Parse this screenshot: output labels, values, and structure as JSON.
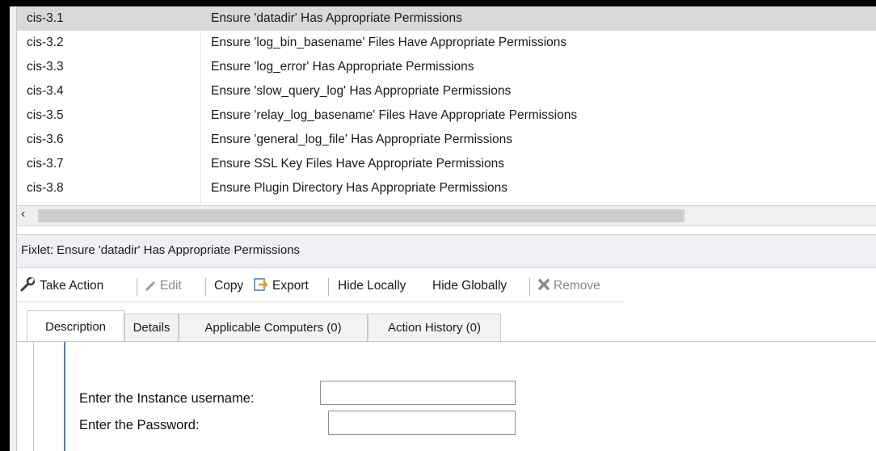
{
  "list": {
    "rows": [
      {
        "id": "cis-3.1",
        "name": "Ensure 'datadir' Has Appropriate Permissions",
        "selected": true
      },
      {
        "id": "cis-3.2",
        "name": "Ensure 'log_bin_basename' Files Have Appropriate Permissions"
      },
      {
        "id": "cis-3.3",
        "name": "Ensure 'log_error' Has Appropriate Permissions"
      },
      {
        "id": "cis-3.4",
        "name": "Ensure 'slow_query_log' Has Appropriate Permissions"
      },
      {
        "id": "cis-3.5",
        "name": "Ensure 'relay_log_basename' Files Have Appropriate Permissions"
      },
      {
        "id": "cis-3.6",
        "name": "Ensure 'general_log_file' Has Appropriate Permissions"
      },
      {
        "id": "cis-3.7",
        "name": "Ensure SSL Key Files Have Appropriate Permissions"
      },
      {
        "id": "cis-3.8",
        "name": "Ensure Plugin Directory Has Appropriate Permissions"
      }
    ]
  },
  "fixlet": {
    "header": "Fixlet: Ensure 'datadir' Has Appropriate Permissions"
  },
  "toolbar": {
    "take_action": "Take Action",
    "edit": "Edit",
    "copy": "Copy",
    "export": "Export",
    "hide_locally": "Hide Locally",
    "hide_globally": "Hide Globally",
    "remove": "Remove"
  },
  "tabs": {
    "description": "Description",
    "details": "Details",
    "applicable": "Applicable Computers (0)",
    "history": "Action History (0)"
  },
  "form": {
    "username_label": "Enter the Instance username:",
    "username_value": "",
    "password_label": "Enter the Password:",
    "password_value": ""
  },
  "colors": {
    "selected_row": "#d9d9d9",
    "accent_bar": "#4a7fc1"
  }
}
